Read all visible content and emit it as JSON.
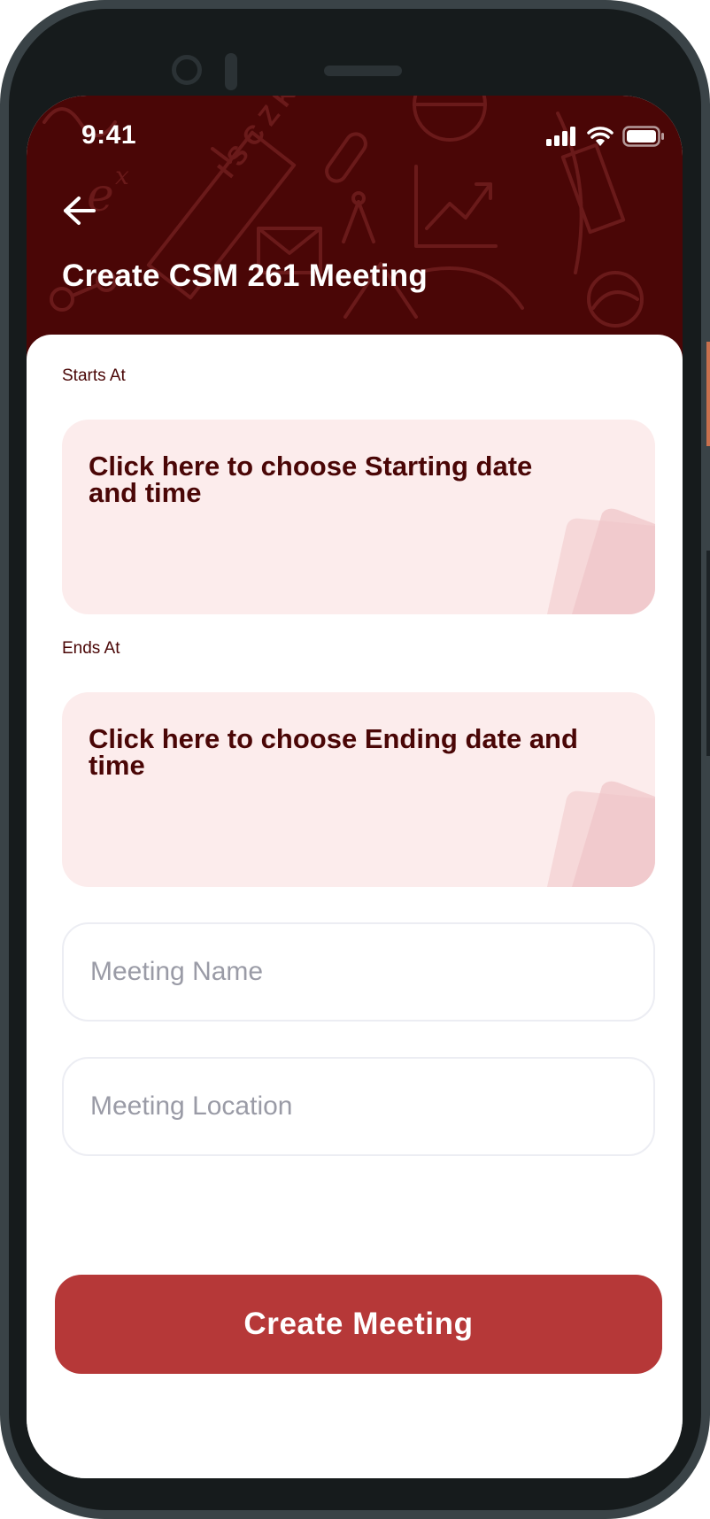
{
  "status_bar": {
    "time": "9:41",
    "icons": [
      "cellular-signal-icon",
      "wifi-icon",
      "battery-icon"
    ]
  },
  "header": {
    "back_icon": "arrow-left-icon",
    "title": "Create CSM 261 Meeting"
  },
  "form": {
    "starts_at": {
      "label": "Starts At",
      "card_text": "Click here to choose Starting date and time"
    },
    "ends_at": {
      "label": "Ends At",
      "card_text": "Click here to choose Ending date and time"
    },
    "meeting_name": {
      "value": "",
      "placeholder": "Meeting Name"
    },
    "meeting_location": {
      "value": "",
      "placeholder": "Meeting Location"
    }
  },
  "actions": {
    "create_label": "Create Meeting"
  },
  "colors": {
    "header_bg": "#4a0606",
    "card_bg": "#fcecec",
    "card_text": "#4a0606",
    "button_bg": "#b63838",
    "placeholder": "#9a9ba6"
  }
}
